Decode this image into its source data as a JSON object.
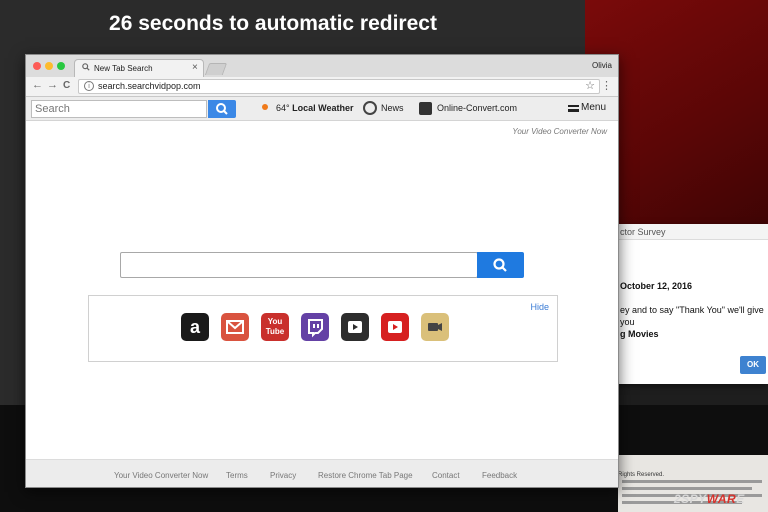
{
  "overlay": {
    "redirect_title": "26 seconds to automatic redirect"
  },
  "browser": {
    "tab_title": "New Tab Search",
    "tab_close": "×",
    "profile_name": "Olivia",
    "url": "search.searchvidpop.com",
    "icons": {
      "back": "←",
      "forward": "→",
      "reload": "C",
      "info": "i",
      "bookmark": "☆",
      "menu": "⋮"
    }
  },
  "toolbar": {
    "search_placeholder": "Search",
    "weather_temp": "64°",
    "weather_label": "Local Weather",
    "news_label": "News",
    "convert_label": "Online-Convert.com",
    "menu_label": "Menu"
  },
  "page": {
    "brand_link": "Your Video Converter Now",
    "hide_link": "Hide",
    "shortcuts": [
      {
        "name": "amazon",
        "label": "a",
        "color": "#1a1a1a"
      },
      {
        "name": "gmail",
        "label": "",
        "color": "#d9533f"
      },
      {
        "name": "youtube",
        "label": "You Tube",
        "color": "#c9302c"
      },
      {
        "name": "twitch",
        "label": "",
        "color": "#6441a5"
      },
      {
        "name": "video-player",
        "label": "",
        "color": "#2d2d2d"
      },
      {
        "name": "youtube-play",
        "label": "",
        "color": "#d62020"
      },
      {
        "name": "video-converter",
        "label": "",
        "color": "#dac07a"
      }
    ]
  },
  "footer": {
    "links": [
      "Your Video Converter Now",
      "Terms",
      "Privacy",
      "Restore Chrome Tab Page",
      "Contact",
      "Feedback"
    ]
  },
  "survey": {
    "header": "ctor Survey",
    "date": "October 12, 2016",
    "text_line1": "ey and to say \"Thank You\" we'll give you",
    "text_line2": "g Movies",
    "ok_label": "OK",
    "footer_text": "Rights Reserved."
  },
  "watermark": {
    "prefix": "2SPY",
    "highlight": "WAR",
    "suffix": "E"
  },
  "colors": {
    "accent_blue": "#1f7ae0",
    "background_red": "#7a0a0a"
  }
}
